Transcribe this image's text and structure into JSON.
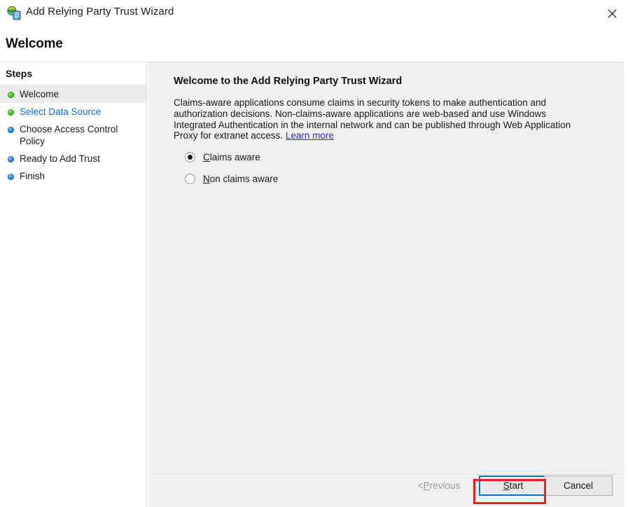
{
  "window": {
    "title": "Add Relying Party Trust Wizard",
    "icon": "relying-party-trust-icon",
    "close_label": "✕"
  },
  "page": {
    "title": "Welcome"
  },
  "sidebar": {
    "header": "Steps",
    "items": [
      {
        "label": "Welcome",
        "bullet": "green",
        "state": "current"
      },
      {
        "label": "Select Data Source",
        "bullet": "green",
        "state": "link"
      },
      {
        "label": "Choose Access Control Policy",
        "bullet": "blue",
        "state": "pending"
      },
      {
        "label": "Ready to Add Trust",
        "bullet": "blue",
        "state": "pending"
      },
      {
        "label": "Finish",
        "bullet": "blue",
        "state": "pending"
      }
    ]
  },
  "content": {
    "heading": "Welcome to the Add Relying Party Trust Wizard",
    "body": "Claims-aware applications consume claims in security tokens to make authentication and authorization decisions. Non-claims-aware applications are web-based and use Windows Integrated Authentication in the internal network and can be published through Web Application Proxy for extranet access. ",
    "link_label": "Learn more",
    "options": [
      {
        "label_accel": "C",
        "label_rest": "laims aware",
        "selected": true
      },
      {
        "label_accel": "N",
        "label_rest": "on claims aware",
        "selected": false
      }
    ]
  },
  "buttons": {
    "previous": {
      "prefix": "< ",
      "accel": "P",
      "rest": "revious",
      "enabled": false
    },
    "start": {
      "accel": "S",
      "prefix": "",
      "rest": "tart",
      "enabled": true,
      "focused": true
    },
    "cancel": {
      "label": "Cancel",
      "enabled": true
    }
  },
  "colors": {
    "link_blue": "#1668d6",
    "inline_link": "#2a2ac0",
    "focus_border": "#0a72c7",
    "annotation_red": "#e8241f",
    "panel_bg": "#f0f0f0",
    "current_step_bg": "#ececec"
  }
}
